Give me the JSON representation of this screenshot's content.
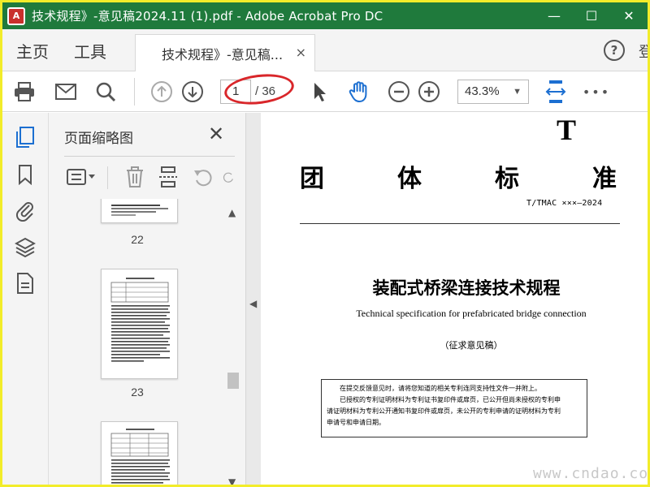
{
  "window": {
    "title": "技术规程》-意见稿2024.11 (1).pdf - Adobe Acrobat Pro DC",
    "app_icon_label": "A",
    "minimize": "—",
    "maximize": "☐",
    "close": "✕"
  },
  "menu": {
    "home": "主页",
    "tools": "工具",
    "tab_label": "技术规程》-意见稿...",
    "tab_close": "×",
    "help": "?",
    "login_partial": "登"
  },
  "toolbar": {
    "page_current": "1",
    "page_total": "/ 36",
    "zoom": "43.3%",
    "zoom_caret": "▼",
    "more": "•••"
  },
  "thumbnails_panel": {
    "title": "页面缩略图",
    "close": "✕",
    "pages": [
      "22",
      "23"
    ]
  },
  "document": {
    "big_letter": "T",
    "std_chars": [
      "团",
      "体",
      "标",
      "准"
    ],
    "std_code": "T/TMAC  ×××—2024",
    "title_cn": "装配式桥梁连接技术规程",
    "title_en": "Technical specification for prefabricated bridge connection",
    "draft_label": "（征求意见稿）",
    "note_lines": [
      "在提交反馈意见时，请将您知道的相关专利连同支持性文件一并附上。",
      "已授权的专利证明材料为专利证书复印件或扉页，已公开但尚未授权的专利申",
      "请证明材料为专利公开通知书复印件或扉页，未公开的专利申请的证明材料为专利",
      "申请号和申请日期。"
    ]
  },
  "watermark": "www.cndao.com",
  "colors": {
    "titlebar": "#1f7a3c",
    "frame_border": "#f2ec2a",
    "highlight_ellipse": "#d9262a",
    "accent_blue": "#1c6fd1"
  },
  "icons": {
    "toolbar": [
      "print-icon",
      "email-icon",
      "search-icon",
      "page-up-icon",
      "page-down-icon",
      "select-arrow-icon",
      "hand-icon",
      "zoom-out-icon",
      "zoom-in-icon",
      "fit-page-icon",
      "more-icon"
    ],
    "rail": [
      "pages-icon",
      "bookmark-icon",
      "attachment-icon",
      "layers-icon",
      "document-properties-icon"
    ],
    "thumb_tools": [
      "options-menu-icon",
      "delete-icon",
      "insert-page-icon",
      "rotate-ccw-icon",
      "rotate-cw-icon"
    ]
  }
}
